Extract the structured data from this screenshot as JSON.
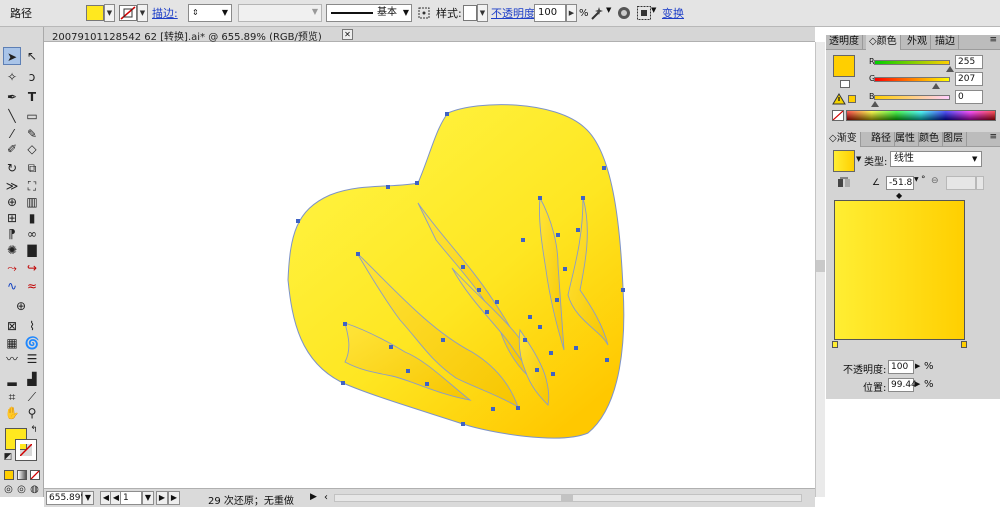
{
  "control_bar": {
    "label": "路径",
    "fill_color": "#ffe81f",
    "stroke_label": "描边:",
    "line_profile": "基本",
    "style_label": "样式:",
    "opacity_label": "不透明度:",
    "opacity_value": "100",
    "opacity_unit": "%",
    "transform_label": "变换"
  },
  "document": {
    "tab_title": "20079101128542 62 [转换].ai* @ 655.89% (RGB/预览)",
    "zoom": "655.89%",
    "page": "1",
    "status_text": "29 次还原；无重做"
  },
  "color_panel": {
    "tabs": [
      "透明度",
      "颜色",
      "外观",
      "描边"
    ],
    "active_tab": "颜色",
    "current_color": "#ffcf00",
    "channels": [
      {
        "name": "R",
        "value": "255"
      },
      {
        "name": "G",
        "value": "207"
      },
      {
        "name": "B",
        "value": "0"
      }
    ]
  },
  "gradient_panel": {
    "tabs": [
      "渐变",
      "路径",
      "属性",
      "颜色",
      "图层"
    ],
    "active_tab": "渐变",
    "type_label": "类型:",
    "type_value": "线性",
    "angle": "-51.8",
    "degree_unit": "°",
    "start_color": "#ffee33",
    "end_color": "#ffcf00",
    "opacity_label": "不透明度:",
    "opacity_value": "100",
    "position_label": "位置:",
    "position_value": "99.44",
    "percent": "%"
  },
  "icons": {
    "selection": "selection-arrow-icon",
    "direct_selection": "direct-selection-icon",
    "pen": "pen-icon",
    "type": "type-icon",
    "zoom": "zoom-icon",
    "hand": "hand-icon"
  }
}
